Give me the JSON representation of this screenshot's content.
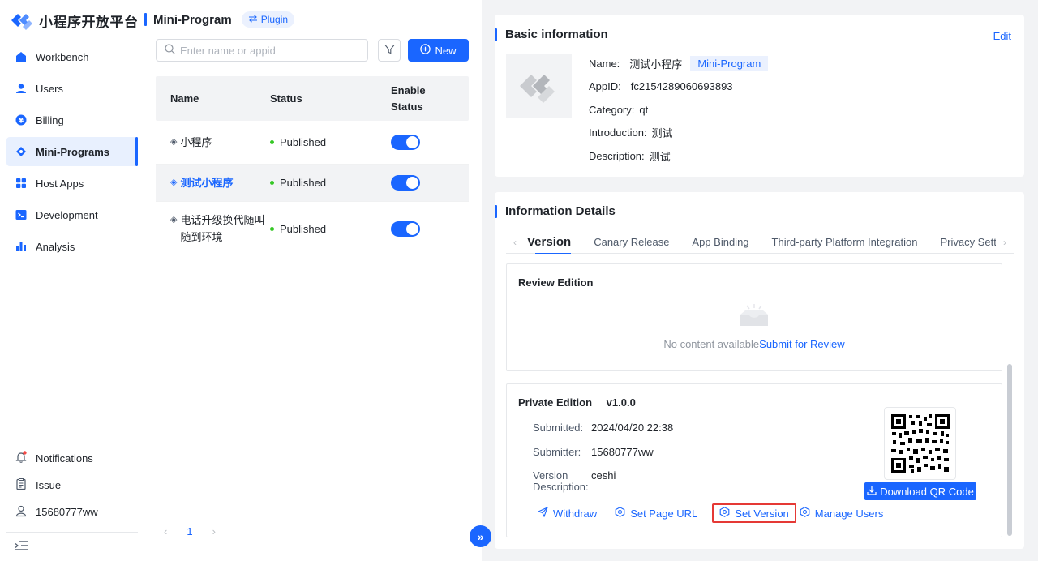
{
  "app": {
    "brand": "小程序开放平台"
  },
  "nav": {
    "items": [
      {
        "label": "Workbench",
        "icon": "workbench-icon"
      },
      {
        "label": "Users",
        "icon": "users-icon"
      },
      {
        "label": "Billing",
        "icon": "billing-icon"
      },
      {
        "label": "Mini-Programs",
        "icon": "mini-programs-icon",
        "active": true
      },
      {
        "label": "Host Apps",
        "icon": "host-apps-icon"
      },
      {
        "label": "Development",
        "icon": "development-icon"
      },
      {
        "label": "Analysis",
        "icon": "analysis-icon"
      }
    ],
    "bottom": {
      "notifications": "Notifications",
      "issue": "Issue",
      "user": "15680777ww"
    }
  },
  "list": {
    "title": "Mini-Program",
    "plugin_tag": "Plugin",
    "search_placeholder": "Enter name or appid",
    "new_label": "New",
    "headers": {
      "name": "Name",
      "status": "Status",
      "enable": "Enable Status"
    },
    "rows": [
      {
        "name": "小程序",
        "status": "Published",
        "enabled": true
      },
      {
        "name": "测试小程序",
        "status": "Published",
        "enabled": true,
        "selected": true
      },
      {
        "name": "电话升级换代随叫随到环境",
        "status": "Published",
        "enabled": true
      }
    ],
    "page": "1"
  },
  "basic": {
    "title": "Basic information",
    "edit": "Edit",
    "name_label": "Name:",
    "name_value": "测试小程序",
    "name_tag": "Mini-Program",
    "appid_label": "AppID:",
    "appid_value": "fc2154289060693893",
    "category_label": "Category:",
    "category_value": "qt",
    "intro_label": "Introduction:",
    "intro_value": "测试",
    "desc_label": "Description:",
    "desc_value": "测试"
  },
  "details": {
    "title": "Information Details",
    "tabs": [
      "Version",
      "Canary Release",
      "App Binding",
      "Third-party Platform Integration",
      "Privacy Sett"
    ],
    "review": {
      "title": "Review Edition",
      "empty": "No content available",
      "submit": "Submit for Review"
    },
    "private": {
      "title": "Private Edition",
      "version": "v1.0.0",
      "submitted_label": "Submitted:",
      "submitted_value": "2024/04/20 22:38",
      "submitter_label": "Submitter:",
      "submitter_value": "15680777ww",
      "vdesc_label": "Version Description:",
      "vdesc_value": "ceshi",
      "download_qr": "Download QR Code",
      "actions": {
        "withdraw": "Withdraw",
        "set_page_url": "Set Page URL",
        "set_version": "Set Version",
        "manage_users": "Manage Users"
      }
    }
  },
  "colors": {
    "accent": "#1a66ff",
    "status_dot": "#34c724",
    "highlight_border": "#e53935"
  }
}
